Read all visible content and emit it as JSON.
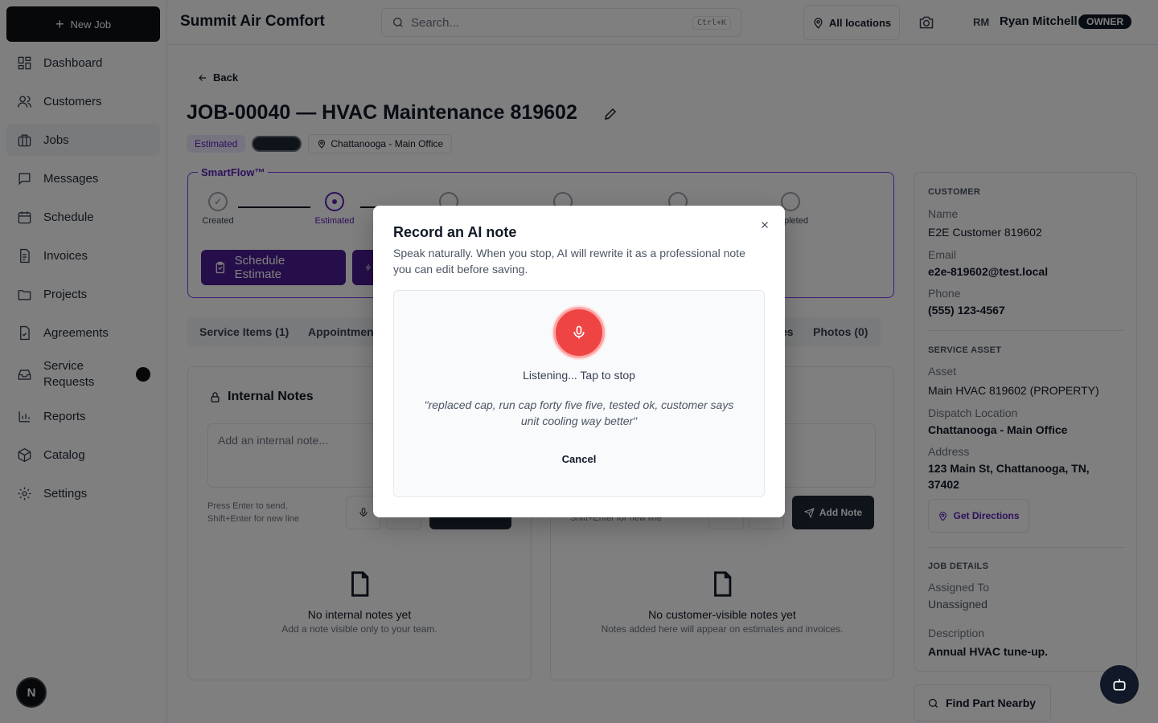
{
  "sidebar": {
    "new_job": "New Job",
    "items": [
      {
        "label": "Dashboard"
      },
      {
        "label": "Customers"
      },
      {
        "label": "Jobs"
      },
      {
        "label": "Messages"
      },
      {
        "label": "Schedule"
      },
      {
        "label": "Invoices"
      },
      {
        "label": "Projects"
      },
      {
        "label": "Agreements"
      },
      {
        "label": "Service Requests"
      },
      {
        "label": "Reports"
      },
      {
        "label": "Catalog"
      },
      {
        "label": "Settings"
      }
    ],
    "bottom_badge": "N"
  },
  "header": {
    "company": "Summit Air Comfort",
    "search_placeholder": "Search...",
    "search_shortcut": "Ctrl+K",
    "locations": "All locations",
    "user_initials": "RM",
    "user_name": "Ryan Mitchell",
    "role": "OWNER"
  },
  "job": {
    "back": "Back",
    "title": "JOB-00040 — HVAC Maintenance 819602",
    "status": "Estimated",
    "location": "Chattanooga - Main Office"
  },
  "smartflow": {
    "label": "SmartFlow™",
    "steps": [
      {
        "label": "Created"
      },
      {
        "label": "Estimated"
      },
      {
        "label": ""
      },
      {
        "label": ""
      },
      {
        "label": ""
      },
      {
        "label": "pleted"
      }
    ],
    "primary_button": "Schedule Estimate"
  },
  "tabs": [
    "Service Items (1)",
    "Appointmen",
    "es",
    "Photos (0)"
  ],
  "internal_notes": {
    "title": "Internal Notes",
    "placeholder": "Add an internal note...",
    "hint": "Press Enter to send,\nShift+Enter for new line",
    "empty_title": "No internal notes yet",
    "empty_sub": "Add a note visible only to your team."
  },
  "customer_notes": {
    "hint": "Shift+Enter for new line",
    "add_button": "Add Note",
    "empty_title": "No customer-visible notes yet",
    "empty_sub": "Notes added here will appear on estimates and invoices."
  },
  "right_panel": {
    "customer_heading": "CUSTOMER",
    "name_label": "Name",
    "name": "E2E Customer 819602",
    "email_label": "Email",
    "email": "e2e-819602@test.local",
    "phone_label": "Phone",
    "phone": "(555) 123-4567",
    "asset_heading": "SERVICE ASSET",
    "asset_label": "Asset",
    "asset": "Main HVAC 819602 (PROPERTY)",
    "dispatch_label": "Dispatch Location",
    "dispatch": "Chattanooga - Main Office",
    "address_label": "Address",
    "address": "123 Main St, Chattanooga, TN, 37402",
    "directions": "Get Directions",
    "job_heading": "JOB DETAILS",
    "assigned_label": "Assigned To",
    "assigned": "Unassigned",
    "description_label": "Description",
    "description": "Annual HVAC tune-up."
  },
  "find_part": "Find Part Nearby",
  "modal": {
    "title": "Record an AI note",
    "description": "Speak naturally. When you stop, AI will rewrite it as a professional note you can edit before saving.",
    "status": "Listening... Tap to stop",
    "transcript": "\"replaced cap, run cap forty five five, tested ok, customer says unit cooling way better\"",
    "cancel": "Cancel"
  },
  "colors": {
    "brand": "#4c1d95",
    "record": "#ef4444",
    "overlay": "rgba(0,0,0,0.5)"
  }
}
